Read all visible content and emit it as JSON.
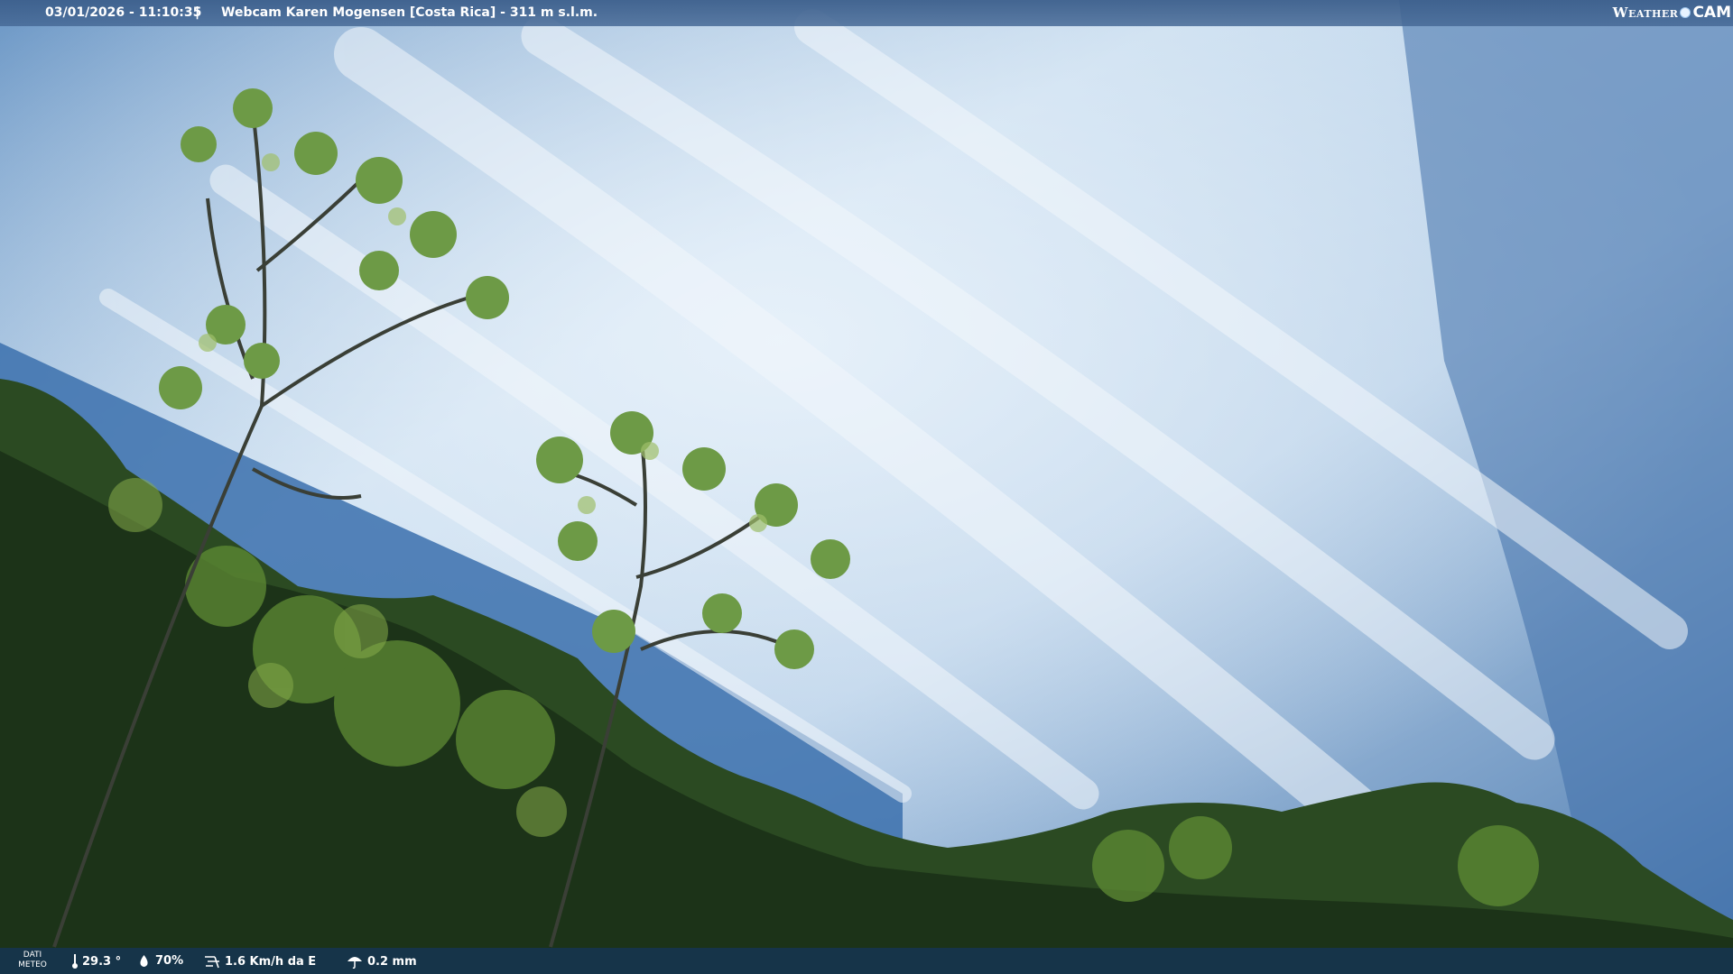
{
  "header": {
    "datetime": "03/01/2026 - 11:10:35",
    "separator": "|",
    "title": "Webcam Karen Mogensen [Costa Rica]  - 311 m s.l.m.",
    "logo_left": "Weather",
    "logo_right": "CAM"
  },
  "footer": {
    "dati_label_1": "DATI",
    "dati_label_2": "METEO",
    "temperature": "29.3 °",
    "humidity": "70%",
    "wind": "1.6 Km/h da E",
    "rain": "0.2 mm",
    "icons": [
      "thermometer-icon",
      "humidity-icon",
      "wind-icon",
      "rain-icon"
    ]
  },
  "colors": {
    "sky_top": "#5b86b8",
    "sky_light": "#d9e8f5",
    "foliage_dark": "#1f3a1c",
    "foliage_light": "#6e9a3c",
    "footer_bg": "#16344e"
  }
}
